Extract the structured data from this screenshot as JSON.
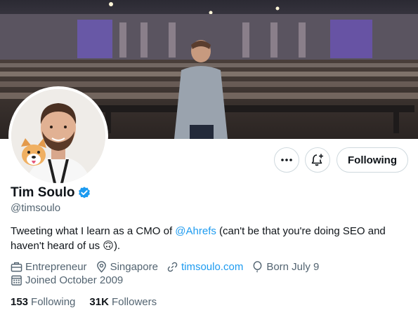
{
  "profile": {
    "name": "Tim Soulo",
    "handle": "@timsoulo",
    "bio": {
      "part1": "Tweeting what I learn as a CMO of ",
      "mention": "@Ahrefs",
      "part2": " (can't be that you're doing SEO and haven't heard of us ",
      "emoji": "🙃",
      "part3": ")."
    },
    "occupation": "Entrepreneur",
    "location": "Singapore",
    "website": "timsoulo.com",
    "birthday": "Born July 9",
    "joined": "Joined October 2009"
  },
  "actions": {
    "follow_label": "Following"
  },
  "stats": {
    "following_count": "153",
    "following_label": "Following",
    "followers_count": "31K",
    "followers_label": "Followers"
  },
  "icons": {
    "more": "more-icon",
    "notify": "bell-plus-icon",
    "verified": "verified-badge-icon",
    "occupation": "briefcase-icon",
    "location": "location-pin-icon",
    "website": "link-icon",
    "birthday": "balloon-icon",
    "joined": "calendar-icon"
  },
  "colors": {
    "accent": "#1d9bf0",
    "text": "#0f1419",
    "secondary": "#536471"
  }
}
